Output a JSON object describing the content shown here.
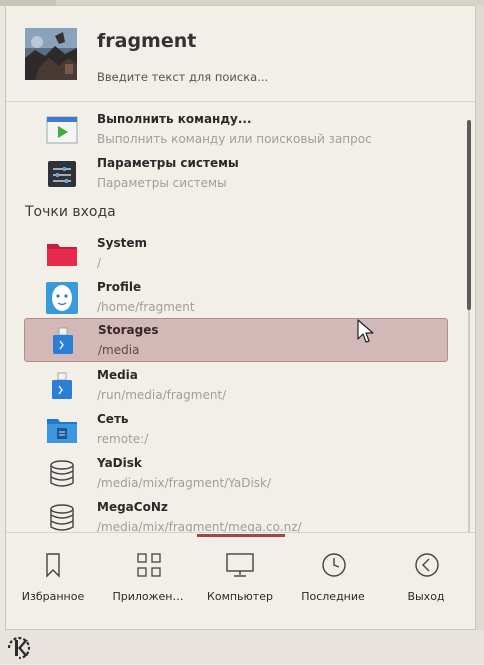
{
  "user": {
    "name": "fragment"
  },
  "search": {
    "placeholder": "Введите текст для поиска..."
  },
  "commands": [
    {
      "title": "Выполнить команду...",
      "subtitle": "Выполнить команду или поисковый запрос",
      "icon": "run-command-icon"
    },
    {
      "title": "Параметры системы",
      "subtitle": "Параметры системы",
      "icon": "system-settings-icon"
    }
  ],
  "places": {
    "heading": "Точки входа",
    "items": [
      {
        "title": "System",
        "subtitle": "/",
        "icon": "red-folder-icon"
      },
      {
        "title": "Profile",
        "subtitle": "/home/fragment",
        "icon": "profile-icon"
      },
      {
        "title": "Storages",
        "subtitle": "/media",
        "icon": "usb-drive-icon",
        "selected": true
      },
      {
        "title": "Media",
        "subtitle": "/run/media/fragment/",
        "icon": "usb-drive-icon"
      },
      {
        "title": "Сеть",
        "subtitle": "remote:/",
        "icon": "network-folder-icon"
      },
      {
        "title": "YaDisk",
        "subtitle": "/media/mix/fragment/YaDisk/",
        "icon": "database-icon"
      },
      {
        "title": "MegaCoNz",
        "subtitle": "/media/mix/fragment/mega.co.nz/",
        "icon": "database-icon"
      }
    ]
  },
  "tabs": [
    {
      "label": "Избранное",
      "icon": "bookmark-icon"
    },
    {
      "label": "Приложен…",
      "icon": "grid-icon"
    },
    {
      "label": "Компьютер",
      "icon": "monitor-icon",
      "active": true
    },
    {
      "label": "Последние",
      "icon": "clock-icon"
    },
    {
      "label": "Выход",
      "icon": "exit-icon"
    }
  ],
  "colors": {
    "accent": "#a04848",
    "selection": "#d2b8b7",
    "background": "#f2efe9"
  }
}
